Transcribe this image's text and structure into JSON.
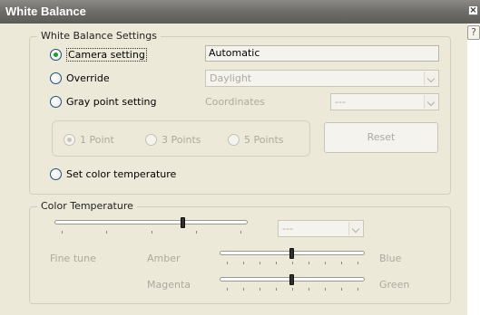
{
  "window": {
    "title": "White Balance",
    "close_glyph": "×",
    "help_glyph": "?"
  },
  "wb_settings": {
    "legend": "White Balance Settings",
    "camera_setting": {
      "label": "Camera setting",
      "checked": true,
      "value": "Automatic"
    },
    "override": {
      "label": "Override",
      "checked": false,
      "selected": "Daylight"
    },
    "gray_point": {
      "label": "Gray point setting",
      "checked": false,
      "coordinates_label": "Coordinates",
      "coordinates_value": "---"
    },
    "points": [
      {
        "label": "1 Point",
        "checked": true
      },
      {
        "label": "3 Points",
        "checked": false
      },
      {
        "label": "5 Points",
        "checked": false
      }
    ],
    "reset_label": "Reset",
    "set_color_temp": {
      "label": "Set color temperature",
      "checked": false
    }
  },
  "color_temperature": {
    "legend": "Color Temperature",
    "main_slider_value": 0.67,
    "preset_value": "---",
    "fine_tune_label": "Fine tune",
    "amber_label": "Amber",
    "blue_label": "Blue",
    "amber_blue_value": 0.5,
    "magenta_label": "Magenta",
    "green_label": "Green",
    "magenta_green_value": 0.5
  }
}
